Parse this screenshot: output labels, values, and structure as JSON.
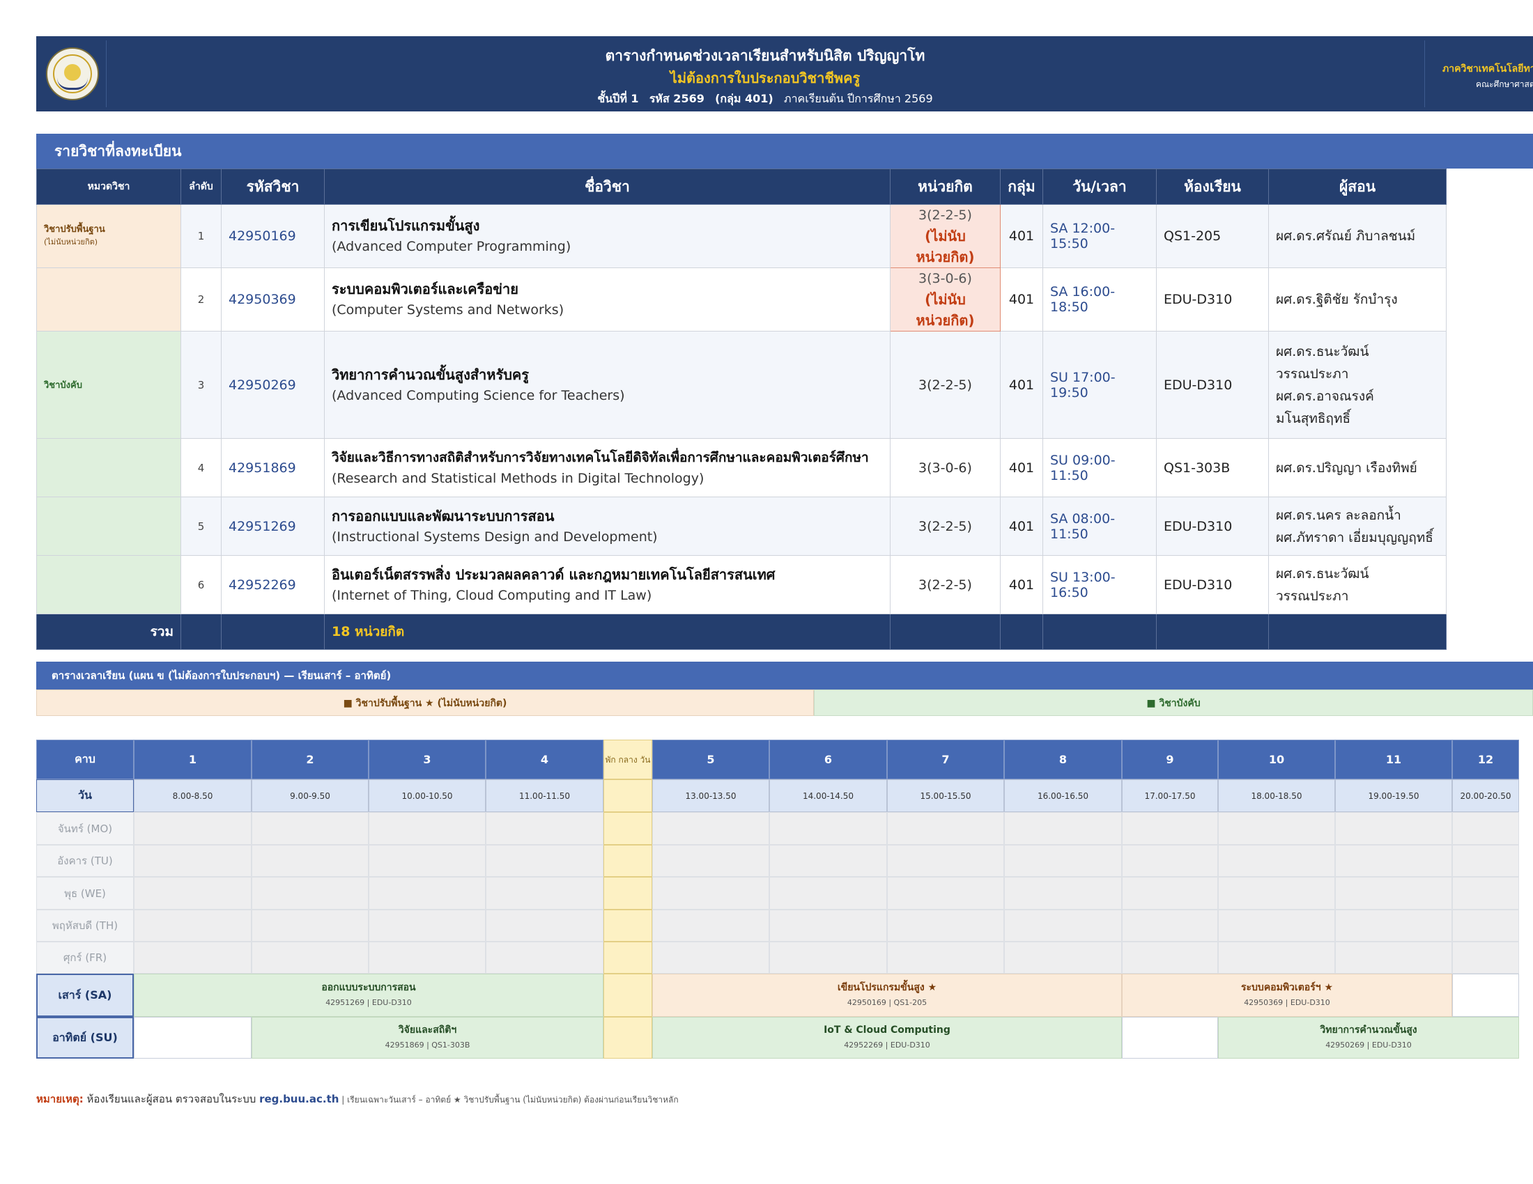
{
  "header": {
    "title": "ตารางกำหนดช่วงเวลาเรียนสำหรับนิสิต  ปริญญาโท",
    "subtitle": "ไม่ต้องการใบประกอบวิชาชีพครู",
    "year_label": "ชั้นปีที่ 1",
    "code_label": "รหัส 2569",
    "group_label": "(กลุ่ม 401)",
    "term": "ภาคเรียนต้น ปีการศึกษา 2569",
    "dept": "ภาควิชาเทคโนโลยีทาง",
    "faculty": "คณะศึกษาศาสต"
  },
  "courses": {
    "section_title": "รายวิชาที่ลงทะเบียน",
    "headers": {
      "category": "หมวดวิชา",
      "no": "ลำดับ",
      "code": "รหัสวิชา",
      "name": "ชื่อวิชา",
      "credits": "หน่วยกิต",
      "group": "กลุ่ม",
      "datetime": "วัน/เวลา",
      "room": "ห้องเรียน",
      "instructor": "ผู้สอน"
    },
    "categories": {
      "foundation": "วิชาปรับพื้นฐาน",
      "foundation_note": "(ไม่นับหน่วยกิต)",
      "required": "วิชาบังคับ"
    },
    "rows": [
      {
        "no": "1",
        "code": "42950169",
        "name_th": "การเขียนโปรแกรมขั้นสูง",
        "name_en": "(Advanced Computer Programming)",
        "credits": "3(2-2-5)",
        "credit_note": "(ไม่นับหน่วยกิต)",
        "group": "401",
        "datetime": "SA 12:00-15:50",
        "room": "QS1-205",
        "instructor": [
          "ผศ.ดร.ศรัณย์ ภิบาลชนม์"
        ]
      },
      {
        "no": "2",
        "code": "42950369",
        "name_th": "ระบบคอมพิวเตอร์และเครือข่าย",
        "name_en": "(Computer Systems and Networks)",
        "credits": "3(3-0-6)",
        "credit_note": "(ไม่นับหน่วยกิต)",
        "group": "401",
        "datetime": "SA 16:00-18:50",
        "room": "EDU-D310",
        "instructor": [
          "ผศ.ดร.ฐิติชัย รักบำรุง"
        ]
      },
      {
        "no": "3",
        "code": "42950269",
        "name_th": "วิทยาการคำนวณขั้นสูงสำหรับครู",
        "name_en": "(Advanced Computing Science for Teachers)",
        "credits": "3(2-2-5)",
        "group": "401",
        "datetime": "SU 17:00-19:50",
        "room": "EDU-D310",
        "instructor": [
          "ผศ.ดร.ธนะวัฒน์",
          "วรรณประภา",
          "ผศ.ดร.อาจณรงค์",
          "มโนสุทธิฤทธิ์"
        ]
      },
      {
        "no": "4",
        "code": "42951869",
        "name_th": "วิจัยและวิธีการทางสถิติสำหรับการวิจัยทางเทคโนโลยีดิจิทัลเพื่อการศึกษาและคอมพิวเตอร์ศึกษา",
        "name_en": "(Research and Statistical Methods in Digital Technology)",
        "credits": "3(3-0-6)",
        "group": "401",
        "datetime": "SU 09:00-11:50",
        "room": "QS1-303B",
        "instructor": [
          "ผศ.ดร.ปริญญา เรืองทิพย์"
        ]
      },
      {
        "no": "5",
        "code": "42951269",
        "name_th": "การออกแบบและพัฒนาระบบการสอน",
        "name_en": "(Instructional Systems Design and Development)",
        "credits": "3(2-2-5)",
        "group": "401",
        "datetime": "SA 08:00-11:50",
        "room": "EDU-D310",
        "instructor": [
          "ผศ.ดร.นคร ละลอกน้ำ",
          "ผศ.ภัทราดา เอี่ยมบุญญฤทธิ์"
        ]
      },
      {
        "no": "6",
        "code": "42952269",
        "name_th": "อินเตอร์เน็ตสรรพสิ่ง ประมวลผลคลาวด์ และกฎหมายเทคโนโลยีสารสนเทศ",
        "name_en": "(Internet of Thing, Cloud Computing and IT Law)",
        "credits": "3(2-2-5)",
        "group": "401",
        "datetime": "SU 13:00-16:50",
        "room": "EDU-D310",
        "instructor": [
          "ผศ.ดร.ธนะวัฒน์",
          "วรรณประภา"
        ]
      }
    ],
    "total_label": "รวม",
    "total_credits": "18  หน่วยกิต"
  },
  "timetable": {
    "section_title": "ตารางเวลาเรียน  (แผน ข (ไม่ต้องการใบประกอบฯ) — เรียนเสาร์ – อาทิตย์)",
    "legend_foundation": "■  วิชาปรับพื้นฐาน ★ (ไม่นับหน่วยกิต)",
    "legend_required": "■  วิชาบังคับ",
    "period_label": "คาบ",
    "day_label": "วัน",
    "lunch_label": "พัก กลาง วัน",
    "periods": [
      "1",
      "2",
      "3",
      "4",
      "5",
      "6",
      "7",
      "8",
      "9",
      "10",
      "11",
      "12"
    ],
    "times": [
      "8.00-8.50",
      "9.00-9.50",
      "10.00-10.50",
      "11.00-11.50",
      "13.00-13.50",
      "14.00-14.50",
      "15.00-15.50",
      "16.00-16.50",
      "17.00-17.50",
      "18.00-18.50",
      "19.00-19.50",
      "20.00-20.50"
    ],
    "weekdays": [
      "จันทร์ (MO)",
      "อังคาร (TU)",
      "พุธ (WE)",
      "พฤหัสบดี (TH)",
      "ศุกร์ (FR)"
    ],
    "saturday": "เสาร์ (SA)",
    "sunday": "อาทิตย์ (SU)",
    "blocks": {
      "sa1": {
        "title": "ออกแบบระบบการสอน",
        "sub": "42951269 | EDU-D310"
      },
      "sa2": {
        "title": "เขียนโปรแกรมขั้นสูง ★",
        "sub": "42950169 | QS1-205"
      },
      "sa3": {
        "title": "ระบบคอมพิวเตอร์ฯ ★",
        "sub": "42950369 | EDU-D310"
      },
      "su1": {
        "title": "วิจัยและสถิติฯ",
        "sub": "42951869 | QS1-303B"
      },
      "su2": {
        "title": "IoT & Cloud Computing",
        "sub": "42952269 | EDU-D310"
      },
      "su3": {
        "title": "วิทยาการคำนวณขั้นสูง",
        "sub": "42950269 | EDU-D310"
      }
    }
  },
  "note": {
    "label": "หมายเหตุ:",
    "text1": " ห้องเรียนและผู้สอน ตรวจสอบในระบบ ",
    "url": "reg.buu.ac.th",
    "text2": "  |  เรียนเฉพาะวันเสาร์ – อาทิตย์  ★ วิชาปรับพื้นฐาน (ไม่นับหน่วยกิต) ต้องผ่านก่อนเรียนวิชาหลัก"
  },
  "colors": {
    "navy": "#243e6e",
    "blue": "#4569b3",
    "gold": "#f3c623",
    "foundation": "#fbebda",
    "required": "#dff0dd",
    "lunch": "#fdf1c4"
  }
}
